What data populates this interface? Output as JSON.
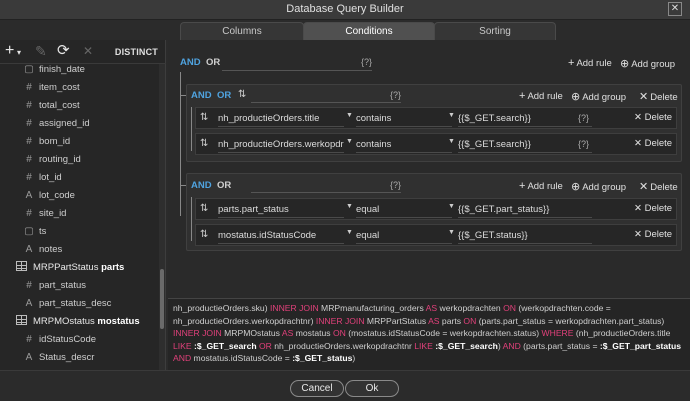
{
  "window": {
    "title": "Database Query Builder",
    "close_glyph": "✕"
  },
  "tabs": [
    {
      "label": "Columns"
    },
    {
      "label": "Conditions"
    },
    {
      "label": "Sorting"
    }
  ],
  "left_toolbar": {
    "add_glyph": "+",
    "add_caret": "▾",
    "edit_glyph": "✎",
    "refresh_glyph": "⟳",
    "remove_glyph": "✕",
    "distinct_label": "DISTINCT"
  },
  "tree": {
    "items": [
      {
        "type": "date",
        "glyph": "▢",
        "label": "finish_date"
      },
      {
        "type": "number",
        "glyph": "#",
        "label": "item_cost"
      },
      {
        "type": "number",
        "glyph": "#",
        "label": "total_cost"
      },
      {
        "type": "number",
        "glyph": "#",
        "label": "assigned_id"
      },
      {
        "type": "number",
        "glyph": "#",
        "label": "bom_id"
      },
      {
        "type": "number",
        "glyph": "#",
        "label": "routing_id"
      },
      {
        "type": "number",
        "glyph": "#",
        "label": "lot_id"
      },
      {
        "type": "text",
        "glyph": "A",
        "label": "lot_code"
      },
      {
        "type": "number",
        "glyph": "#",
        "label": "site_id"
      },
      {
        "type": "date",
        "glyph": "▢",
        "label": "ts"
      },
      {
        "type": "text",
        "glyph": "A",
        "label": "notes"
      }
    ],
    "table1": {
      "name": "MRPPartStatus",
      "alias": "parts"
    },
    "table1_items": [
      {
        "type": "number",
        "glyph": "#",
        "label": "part_status"
      },
      {
        "type": "text",
        "glyph": "A",
        "label": "part_status_desc"
      }
    ],
    "table2": {
      "name": "MRPMOstatus",
      "alias": "mostatus"
    },
    "table2_items": [
      {
        "type": "number",
        "glyph": "#",
        "label": "idStatusCode"
      },
      {
        "type": "text",
        "glyph": "A",
        "label": "Status_descr"
      }
    ]
  },
  "conditions": {
    "and_label": "AND",
    "or_label": "OR",
    "fx_glyph": "{?}",
    "sort_glyph": "⇅",
    "add_rule_label": "Add rule",
    "add_group_label": "Add group",
    "delete_label": "Delete",
    "plus_glyph": "+",
    "circle_plus_glyph": "⊕",
    "x_glyph": "✕",
    "caret_glyph": "▼",
    "group1": {
      "rules": [
        {
          "field": "nh_productieOrders.title",
          "operator": "contains",
          "value": "{{$_GET.search}}"
        },
        {
          "field": "nh_productieOrders.werkopdrachtnr",
          "operator": "contains",
          "value": "{{$_GET.search}}"
        }
      ]
    },
    "group2": {
      "rules": [
        {
          "field": "parts.part_status",
          "operator": "equal",
          "value": "{{$_GET.part_status}}"
        },
        {
          "field": "mostatus.idStatusCode",
          "operator": "equal",
          "value": "{{$_GET.status}}"
        }
      ]
    }
  },
  "sql": {
    "parts": [
      [
        "t",
        "nh_productieOrders.sku) "
      ],
      [
        "k",
        "INNER JOIN"
      ],
      [
        "t",
        " MRPmanufacturing_orders "
      ],
      [
        "k",
        "AS"
      ],
      [
        "t",
        " werkopdrachten "
      ],
      [
        "k",
        "ON"
      ],
      [
        "t",
        " (werkopdrachten.code = nh_productieOrders.werkopdrachtnr) "
      ],
      [
        "k",
        "INNER JOIN"
      ],
      [
        "t",
        " MRPPartStatus "
      ],
      [
        "k",
        "AS"
      ],
      [
        "t",
        " parts "
      ],
      [
        "k",
        "ON"
      ],
      [
        "t",
        " (parts.part_status = werkopdrachten.part_status) "
      ],
      [
        "k",
        "INNER JOIN"
      ],
      [
        "t",
        " MRPMOstatus "
      ],
      [
        "k",
        "AS"
      ],
      [
        "t",
        " mostatus "
      ],
      [
        "k",
        "ON"
      ],
      [
        "t",
        " (mostatus.idStatusCode = werkopdrachten.status) "
      ],
      [
        "k",
        "WHERE"
      ],
      [
        "t",
        " (nh_productieOrders.title "
      ],
      [
        "k",
        "LIKE"
      ],
      [
        "s",
        " :$_GET_search"
      ],
      [
        "t",
        " "
      ],
      [
        "k",
        "OR"
      ],
      [
        "t",
        " nh_productieOrders.werkopdrachtnr "
      ],
      [
        "k",
        "LIKE"
      ],
      [
        "s",
        " :$_GET_search"
      ],
      [
        "t",
        ") "
      ],
      [
        "k",
        "AND"
      ],
      [
        "t",
        " (parts.part_status = "
      ],
      [
        "s",
        ":$_GET_part_status"
      ],
      [
        "t",
        " "
      ],
      [
        "k",
        "AND"
      ],
      [
        "t",
        " mostatus.idStatusCode = "
      ],
      [
        "s",
        ":$_GET_status"
      ],
      [
        "t",
        ")"
      ]
    ]
  },
  "footer": {
    "cancel_label": "Cancel",
    "ok_label": "Ok"
  }
}
